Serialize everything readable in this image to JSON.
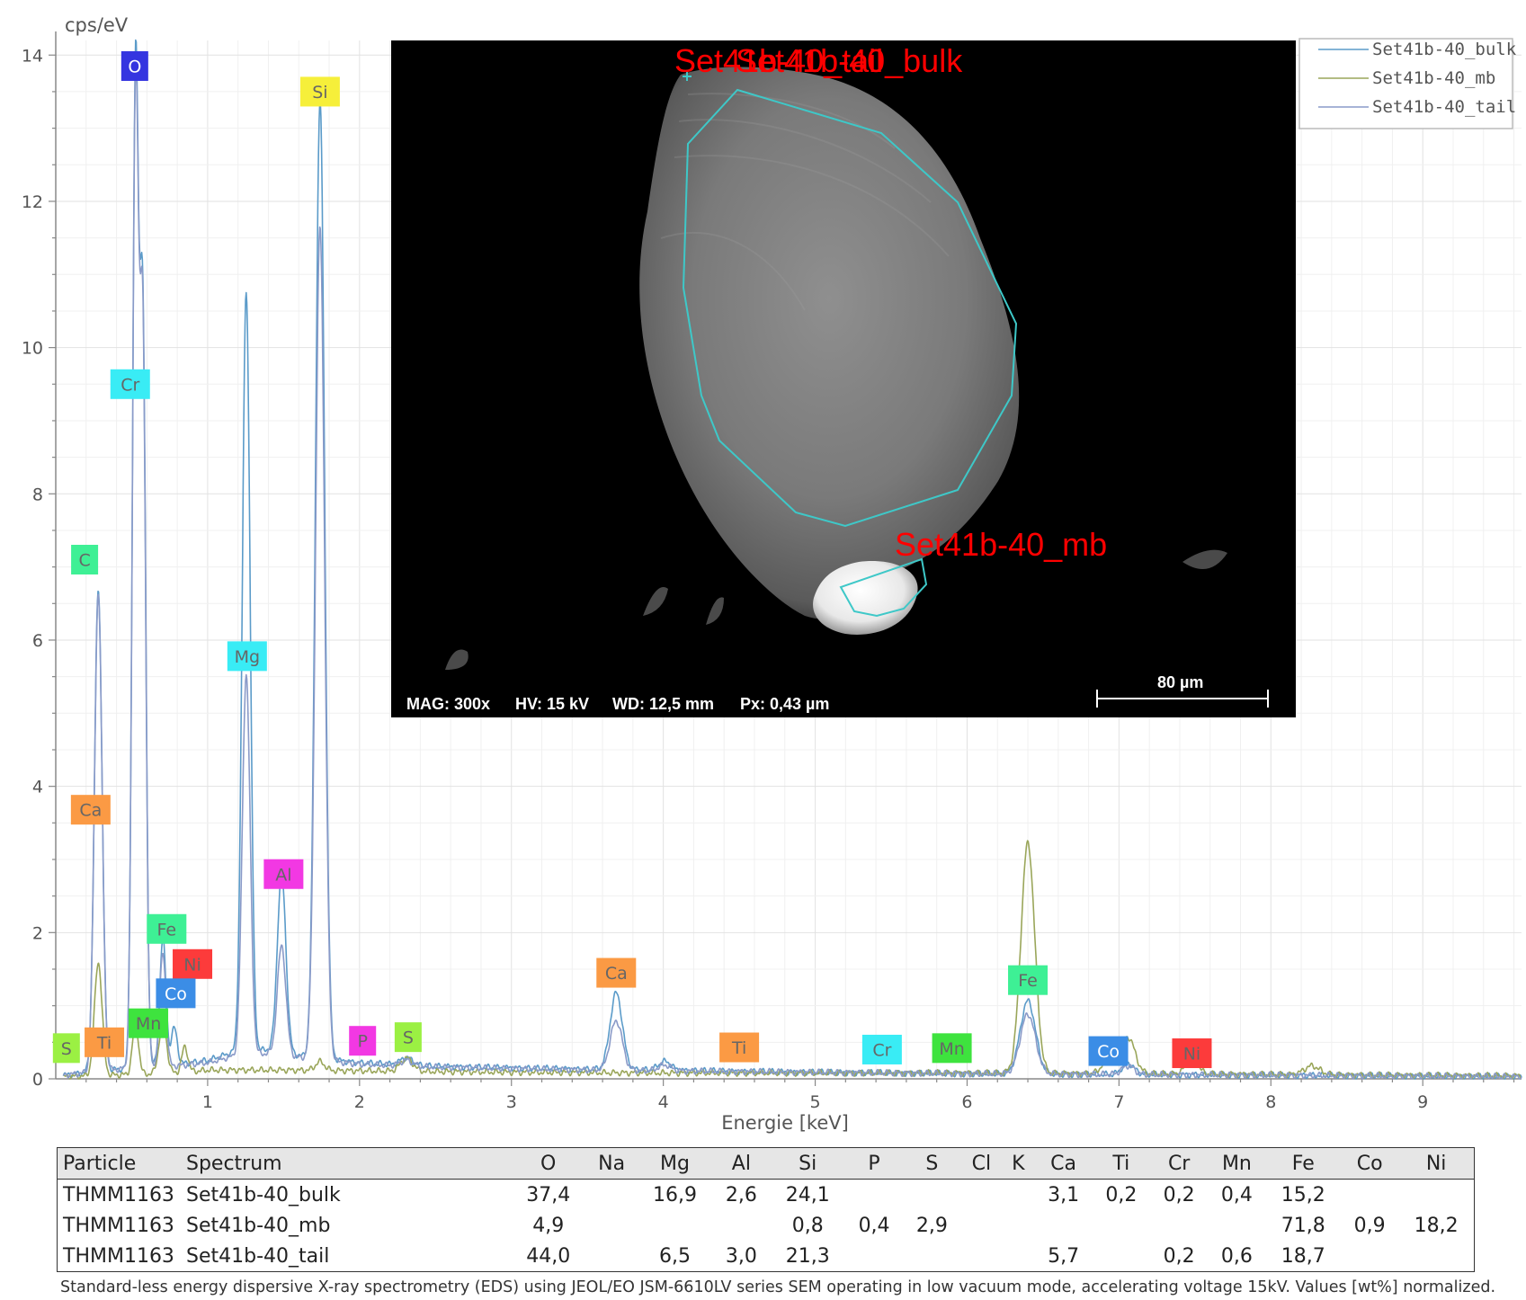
{
  "chart_data": {
    "type": "line",
    "ylabel": "cps/eV",
    "xlabel": "Energie [keV]",
    "xlim": [
      0,
      9.65
    ],
    "ylim": [
      0,
      14.2
    ],
    "x_ticks": [
      1,
      2,
      3,
      4,
      5,
      6,
      7,
      8,
      9
    ],
    "y_ticks": [
      0,
      2,
      4,
      6,
      8,
      10,
      12,
      14
    ],
    "grid": true,
    "legend_position": "top-right",
    "series": [
      {
        "name": "Set41b-40_bulk",
        "color": "#5b9bc9",
        "baseline": [
          [
            0.05,
            0.05
          ],
          [
            0.5,
            0.15
          ],
          [
            0.8,
            0.2
          ],
          [
            1.0,
            0.25
          ],
          [
            1.15,
            0.35
          ],
          [
            1.4,
            0.4
          ],
          [
            1.65,
            0.3
          ],
          [
            2.0,
            0.22
          ],
          [
            2.5,
            0.17
          ],
          [
            3.0,
            0.15
          ],
          [
            3.5,
            0.13
          ],
          [
            4.0,
            0.12
          ],
          [
            4.5,
            0.1
          ],
          [
            5.0,
            0.09
          ],
          [
            5.5,
            0.08
          ],
          [
            6.0,
            0.07
          ],
          [
            7.0,
            0.06
          ],
          [
            8.0,
            0.05
          ],
          [
            9.65,
            0.03
          ]
        ],
        "peaks": [
          [
            0.28,
            6.6,
            0.025
          ],
          [
            0.525,
            13.4,
            0.02
          ],
          [
            0.573,
            10.1,
            0.02
          ],
          [
            0.705,
            1.75,
            0.02
          ],
          [
            0.78,
            0.5,
            0.02
          ],
          [
            1.254,
            10.4,
            0.026
          ],
          [
            1.487,
            2.45,
            0.028
          ],
          [
            1.74,
            13.1,
            0.03
          ],
          [
            2.31,
            0.1,
            0.04
          ],
          [
            3.69,
            1.05,
            0.04
          ],
          [
            4.01,
            0.12,
            0.04
          ],
          [
            6.4,
            1.0,
            0.05
          ],
          [
            7.06,
            0.15,
            0.04
          ]
        ]
      },
      {
        "name": "Set41b-40_mb",
        "color": "#9aa65a",
        "baseline": [
          [
            0.05,
            0.03
          ],
          [
            0.5,
            0.06
          ],
          [
            0.8,
            0.08
          ],
          [
            1.0,
            0.12
          ],
          [
            1.5,
            0.12
          ],
          [
            2.0,
            0.11
          ],
          [
            2.5,
            0.1
          ],
          [
            3.0,
            0.09
          ],
          [
            4.0,
            0.08
          ],
          [
            5.0,
            0.08
          ],
          [
            6.0,
            0.08
          ],
          [
            7.0,
            0.07
          ],
          [
            8.0,
            0.06
          ],
          [
            9.65,
            0.04
          ]
        ],
        "peaks": [
          [
            0.28,
            1.55,
            0.025
          ],
          [
            0.525,
            0.7,
            0.02
          ],
          [
            0.705,
            0.7,
            0.025
          ],
          [
            0.85,
            0.35,
            0.02
          ],
          [
            1.74,
            0.12,
            0.03
          ],
          [
            2.31,
            0.18,
            0.04
          ],
          [
            6.4,
            3.15,
            0.045
          ],
          [
            6.93,
            0.2,
            0.04
          ],
          [
            7.06,
            0.5,
            0.045
          ],
          [
            7.48,
            0.2,
            0.04
          ],
          [
            8.27,
            0.12,
            0.05
          ]
        ]
      },
      {
        "name": "Set41b-40_tail",
        "color": "#8a9ac8",
        "baseline": [
          [
            0.05,
            0.05
          ],
          [
            0.5,
            0.15
          ],
          [
            0.8,
            0.18
          ],
          [
            1.0,
            0.22
          ],
          [
            1.15,
            0.3
          ],
          [
            1.4,
            0.35
          ],
          [
            1.65,
            0.28
          ],
          [
            2.0,
            0.2
          ],
          [
            2.5,
            0.16
          ],
          [
            3.0,
            0.14
          ],
          [
            3.5,
            0.12
          ],
          [
            4.0,
            0.11
          ],
          [
            4.5,
            0.1
          ],
          [
            5.0,
            0.09
          ],
          [
            5.5,
            0.08
          ],
          [
            6.0,
            0.07
          ],
          [
            7.0,
            0.06
          ],
          [
            8.0,
            0.05
          ],
          [
            9.65,
            0.03
          ]
        ],
        "peaks": [
          [
            0.28,
            6.55,
            0.025
          ],
          [
            0.525,
            13.2,
            0.02
          ],
          [
            0.573,
            9.9,
            0.02
          ],
          [
            0.705,
            1.55,
            0.02
          ],
          [
            1.254,
            5.2,
            0.026
          ],
          [
            1.487,
            1.5,
            0.028
          ],
          [
            1.74,
            11.4,
            0.03
          ],
          [
            2.31,
            0.08,
            0.04
          ],
          [
            3.69,
            0.68,
            0.04
          ],
          [
            4.01,
            0.08,
            0.04
          ],
          [
            6.4,
            0.82,
            0.05
          ],
          [
            7.06,
            0.12,
            0.04
          ]
        ]
      }
    ],
    "element_labels": [
      {
        "text": "O",
        "x": 0.52,
        "y": 13.85,
        "color": "#3535e0",
        "fg": "#ffffff"
      },
      {
        "text": "Si",
        "x": 1.74,
        "y": 13.5,
        "color": "#f6ef3a",
        "fg": "#666666"
      },
      {
        "text": "Cr",
        "x": 0.49,
        "y": 9.5,
        "color": "#39ecf5",
        "fg": "#666666"
      },
      {
        "text": "C",
        "x": 0.19,
        "y": 7.1,
        "color": "#3ef095",
        "fg": "#666666"
      },
      {
        "text": "Mg",
        "x": 1.26,
        "y": 5.78,
        "color": "#39ecf5",
        "fg": "#666666"
      },
      {
        "text": "Ca",
        "x": 0.23,
        "y": 3.68,
        "color": "#fb9a44",
        "fg": "#666666"
      },
      {
        "text": "Al",
        "x": 1.5,
        "y": 2.8,
        "color": "#f238e3",
        "fg": "#666666"
      },
      {
        "text": "Fe",
        "x": 0.73,
        "y": 2.05,
        "color": "#3ef095",
        "fg": "#666666"
      },
      {
        "text": "Ni",
        "x": 0.9,
        "y": 1.57,
        "color": "#fc3b3b",
        "fg": "#666666"
      },
      {
        "text": "Co",
        "x": 0.79,
        "y": 1.17,
        "color": "#3b8de6",
        "fg": "#ffffff"
      },
      {
        "text": "Mn",
        "x": 0.61,
        "y": 0.76,
        "color": "#3ee33e",
        "fg": "#666666"
      },
      {
        "text": "S",
        "x": 0.07,
        "y": 0.42,
        "color": "#9bf043",
        "fg": "#666666"
      },
      {
        "text": "Ti",
        "x": 0.32,
        "y": 0.5,
        "color": "#fb9a44",
        "fg": "#666666"
      },
      {
        "text": "P",
        "x": 2.02,
        "y": 0.52,
        "color": "#f238e3",
        "fg": "#666666"
      },
      {
        "text": "S",
        "x": 2.32,
        "y": 0.57,
        "color": "#9bf043",
        "fg": "#666666"
      },
      {
        "text": "Ca",
        "x": 3.69,
        "y": 1.45,
        "color": "#fb9a44",
        "fg": "#666666"
      },
      {
        "text": "Ti",
        "x": 4.5,
        "y": 0.43,
        "color": "#fb9a44",
        "fg": "#666666"
      },
      {
        "text": "Cr",
        "x": 5.44,
        "y": 0.4,
        "color": "#39ecf5",
        "fg": "#666666"
      },
      {
        "text": "Mn",
        "x": 5.9,
        "y": 0.42,
        "color": "#3ee33e",
        "fg": "#666666"
      },
      {
        "text": "Fe",
        "x": 6.4,
        "y": 1.35,
        "color": "#3ef095",
        "fg": "#666666"
      },
      {
        "text": "Co",
        "x": 6.93,
        "y": 0.38,
        "color": "#3b8de6",
        "fg": "#ffffff"
      },
      {
        "text": "Ni",
        "x": 7.48,
        "y": 0.35,
        "color": "#fc3b3b",
        "fg": "#666666"
      }
    ]
  },
  "sem": {
    "info": {
      "mag": "MAG: 300x",
      "hv": "HV: 15 kV",
      "wd": "WD: 12,5 mm",
      "px": "Px: 0,43 µm",
      "scale": "80 µm"
    },
    "roi_labels": {
      "overlap_a": "Set41b-40_tail",
      "overlap_b": "Set41b-40_bulk",
      "mb": "Set41b-40_mb"
    },
    "roi_color": "#3ec8c8",
    "label_color": "#ff0000"
  },
  "table": {
    "headers": [
      "Particle",
      "Spectrum",
      "O",
      "Na",
      "Mg",
      "Al",
      "Si",
      "P",
      "S",
      "Cl",
      "K",
      "Ca",
      "Ti",
      "Cr",
      "Mn",
      "Fe",
      "Co",
      "Ni"
    ],
    "rows": [
      [
        "THMM1163",
        "Set41b-40_bulk",
        "37,4",
        "",
        "16,9",
        "2,6",
        "24,1",
        "",
        "",
        "",
        "",
        "3,1",
        "0,2",
        "0,2",
        "0,4",
        "15,2",
        "",
        ""
      ],
      [
        "THMM1163",
        "Set41b-40_mb",
        "4,9",
        "",
        "",
        "",
        "0,8",
        "0,4",
        "2,9",
        "",
        "",
        "",
        "",
        "",
        "",
        "71,8",
        "0,9",
        "18,2"
      ],
      [
        "THMM1163",
        "Set41b-40_tail",
        "44,0",
        "",
        "6,5",
        "3,0",
        "21,3",
        "",
        "",
        "",
        "",
        "5,7",
        "",
        "0,2",
        "0,6",
        "18,7",
        "",
        ""
      ]
    ]
  },
  "footnote": "Standard-less energy dispersive X-ray spectrometry (EDS) using JEOL/EO JSM-6610LV series SEM operating in low vacuum mode, accelerating voltage 15kV. Values [wt%] normalized."
}
